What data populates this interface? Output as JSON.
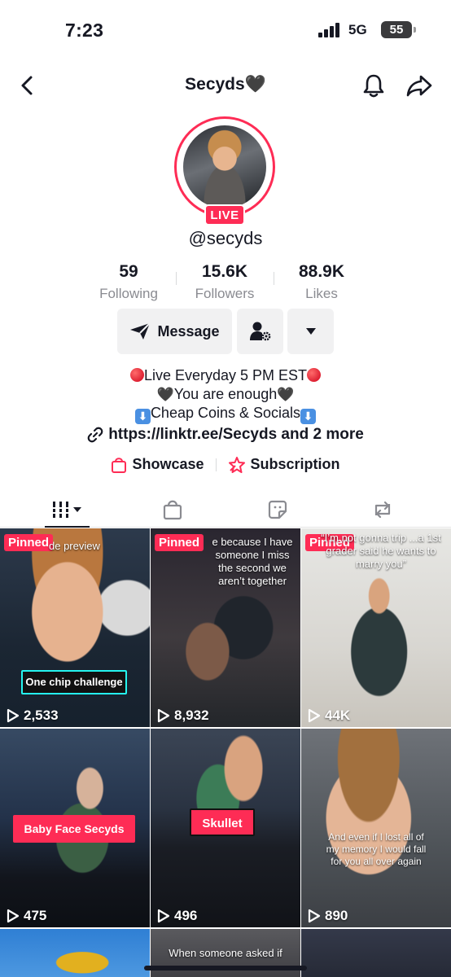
{
  "status_bar": {
    "time": "7:23",
    "network": "5G",
    "battery": "55"
  },
  "nav": {
    "title": "Secyds🖤"
  },
  "profile": {
    "live_label": "LIVE",
    "username": "@secyds",
    "stats": [
      {
        "value": "59",
        "label": "Following"
      },
      {
        "value": "15.6K",
        "label": "Followers"
      },
      {
        "value": "88.9K",
        "label": "Likes"
      }
    ],
    "message_label": "Message",
    "bio": {
      "line1": "Live Everyday 5 PM EST",
      "line2": "You are enough",
      "line3": "Cheap Coins & Socials"
    },
    "link": "https://linktr.ee/Secyds and 2 more",
    "showcase_label": "Showcase",
    "subscription_label": "Subscription"
  },
  "videos": [
    {
      "pinned": "Pinned",
      "views": "2,533",
      "caption": "de preview",
      "sticker": "One chip challenge"
    },
    {
      "pinned": "Pinned",
      "views": "8,932",
      "caption": "e because I have someone I miss the second we aren’t together"
    },
    {
      "pinned": "Pinned",
      "views": "44K",
      "caption": "“I’m not gonna trip ...a 1st grader said he wants to marry you”"
    },
    {
      "views": "475",
      "sticker": "Baby Face Secyds"
    },
    {
      "views": "496",
      "sticker": "Skullet"
    },
    {
      "views": "890",
      "caption": "And even if I lost all of my memory I would fall for you all over again"
    },
    {
      "caption": "When someone asked if"
    },
    {},
    {}
  ],
  "colors": {
    "accent": "#fe2c55",
    "text": "#161823",
    "muted": "#8a8b91"
  }
}
